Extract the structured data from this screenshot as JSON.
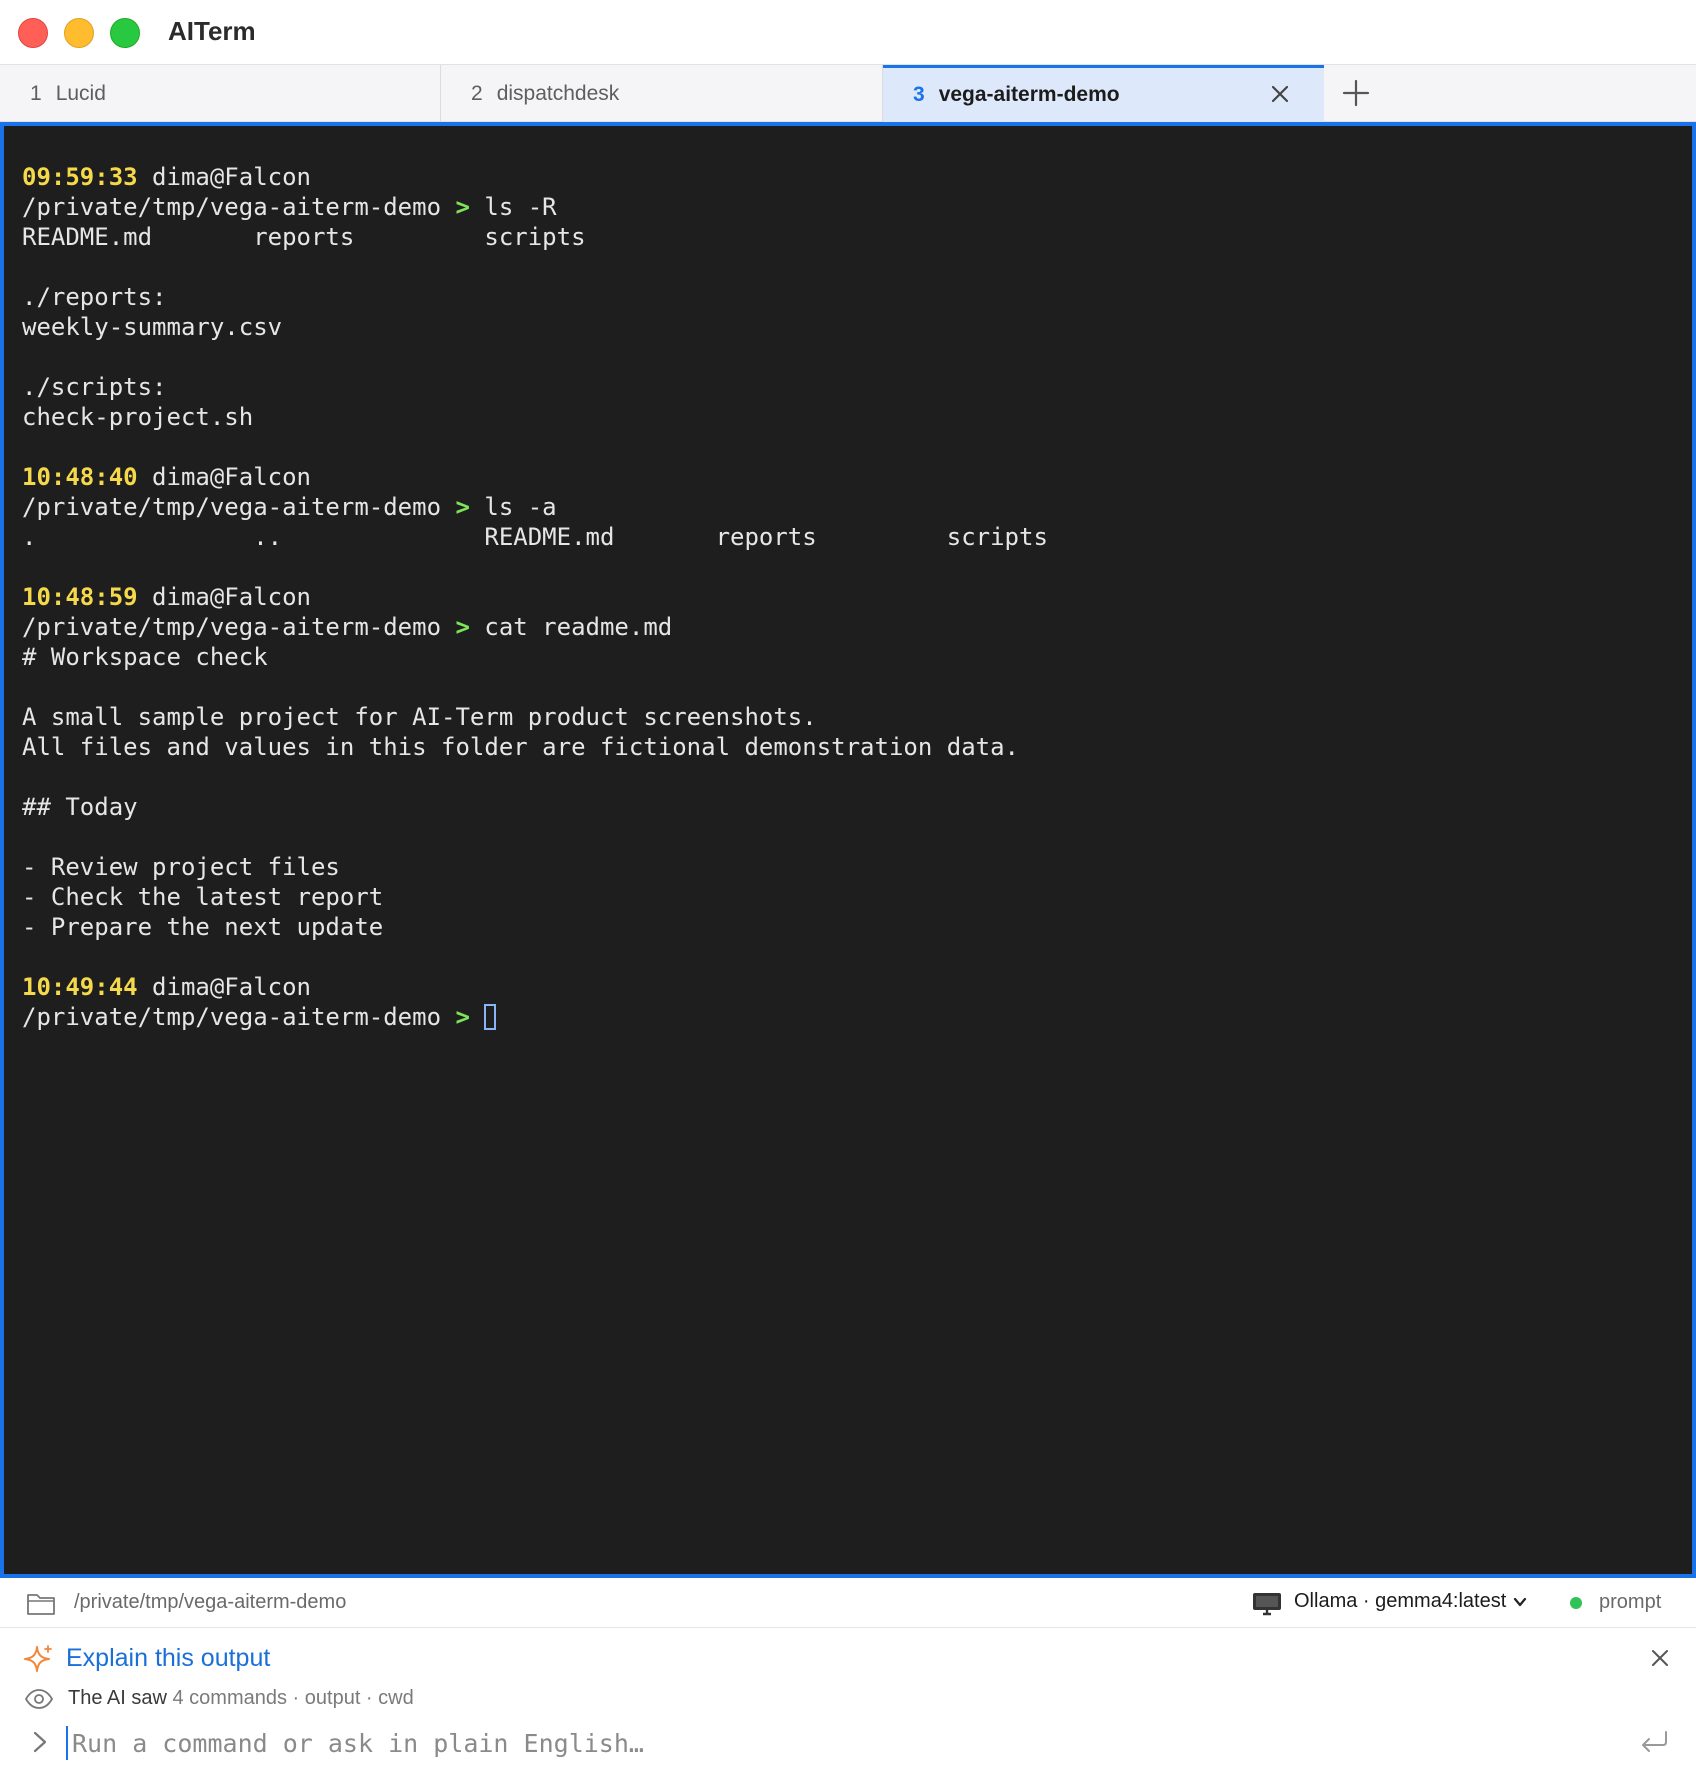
{
  "app": {
    "title": "AITerm"
  },
  "tabs": [
    {
      "num": "1",
      "label": "Lucid"
    },
    {
      "num": "2",
      "label": "dispatchdesk"
    },
    {
      "num": "3",
      "label": "vega-aiterm-demo",
      "active": true
    }
  ],
  "terminal": {
    "lines": [
      {
        "time": "09:59:33",
        "text": " dima@Falcon"
      },
      {
        "text": "/private/tmp/vega-aiterm-demo ",
        "arrow": ">",
        "cmd": " ls -R"
      },
      {
        "text": "README.md       reports         scripts"
      },
      {
        "text": ""
      },
      {
        "text": "./reports:"
      },
      {
        "text": "weekly-summary.csv"
      },
      {
        "text": ""
      },
      {
        "text": "./scripts:"
      },
      {
        "text": "check-project.sh"
      },
      {
        "text": ""
      },
      {
        "time": "10:48:40",
        "text": " dima@Falcon"
      },
      {
        "text": "/private/tmp/vega-aiterm-demo ",
        "arrow": ">",
        "cmd": " ls -a"
      },
      {
        "text": ".               ..              README.md       reports         scripts"
      },
      {
        "text": ""
      },
      {
        "time": "10:48:59",
        "text": " dima@Falcon"
      },
      {
        "text": "/private/tmp/vega-aiterm-demo ",
        "arrow": ">",
        "cmd": " cat readme.md"
      },
      {
        "text": "# Workspace check"
      },
      {
        "text": ""
      },
      {
        "text": "A small sample project for AI-Term product screenshots."
      },
      {
        "text": "All files and values in this folder are fictional demonstration data."
      },
      {
        "text": ""
      },
      {
        "text": "## Today"
      },
      {
        "text": ""
      },
      {
        "text": "- Review project files"
      },
      {
        "text": "- Check the latest report"
      },
      {
        "text": "- Prepare the next update"
      },
      {
        "text": ""
      },
      {
        "time": "10:49:44",
        "text": " dima@Falcon"
      },
      {
        "text": "/private/tmp/vega-aiterm-demo ",
        "arrow": ">",
        "cmd": " ",
        "cursor": true
      }
    ]
  },
  "status": {
    "cwd": "/private/tmp/vega-aiterm-demo",
    "model": "Ollama · gemma4:latest",
    "mode": "prompt",
    "mode_color": "#2fc256"
  },
  "ai_panel": {
    "explain_label": "Explain this output",
    "saw_prefix": "The AI saw",
    "saw_details": "4 commands · output · cwd",
    "input_placeholder": "Run a command or ask in plain English…",
    "input_value": ""
  },
  "colors": {
    "accent": "#1a73e8",
    "terminal_bg": "#1e1e1e",
    "timestamp": "#f5d94a",
    "prompt_arrow": "#7fe35a"
  }
}
